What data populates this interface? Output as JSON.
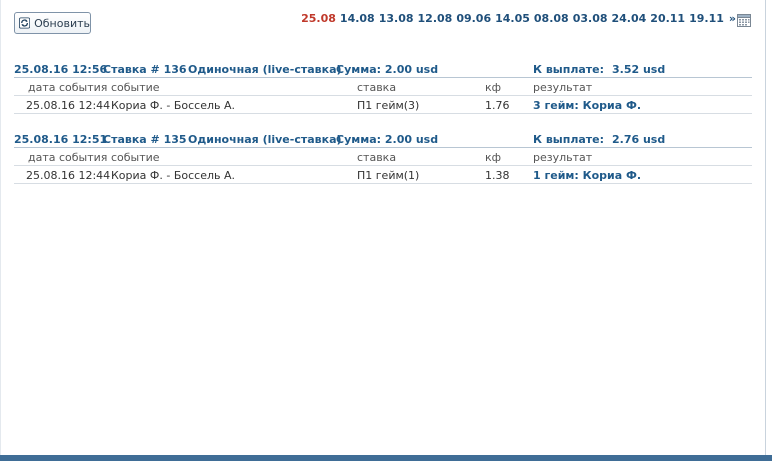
{
  "toolbar": {
    "refresh_label": "Обновить"
  },
  "dates": {
    "items": [
      "25.08",
      "14.08",
      "13.08",
      "12.08",
      "09.06",
      "14.05",
      "08.08",
      "03.08",
      "24.04",
      "20.11",
      "19.11"
    ],
    "active": "25.08",
    "more": "»"
  },
  "columns": {
    "date": "дата события",
    "event": "событие",
    "bet": "ставка",
    "coef": "кф",
    "result": "результат"
  },
  "bets": [
    {
      "datetime": "25.08.16 12:56",
      "bet_no": "Ставка # 136",
      "type": "Одиночная (live-ставка)",
      "amount": "Сумма: 2.00 usd",
      "payout_label": "К выплате:",
      "payout_value": "3.52 usd",
      "row": {
        "date": "25.08.16 12:44",
        "event": "Кориа Ф. - Боссель А.",
        "bet": "П1 гейм(3)",
        "coef": "1.76",
        "result": "3 гейм: Кориа Ф."
      }
    },
    {
      "datetime": "25.08.16 12:51",
      "bet_no": "Ставка # 135",
      "type": "Одиночная (live-ставка)",
      "amount": "Сумма: 2.00 usd",
      "payout_label": "К выплате:",
      "payout_value": "2.76 usd",
      "row": {
        "date": "25.08.16 12:44",
        "event": "Кориа Ф. - Боссель А.",
        "bet": "П1 гейм(1)",
        "coef": "1.38",
        "result": "1 гейм: Кориа Ф."
      }
    }
  ],
  "colors": {
    "active_date": "#c0392b",
    "link": "#1f4f7a",
    "header": "#1f5a8a",
    "bottom_bar": "#3f6d96"
  }
}
